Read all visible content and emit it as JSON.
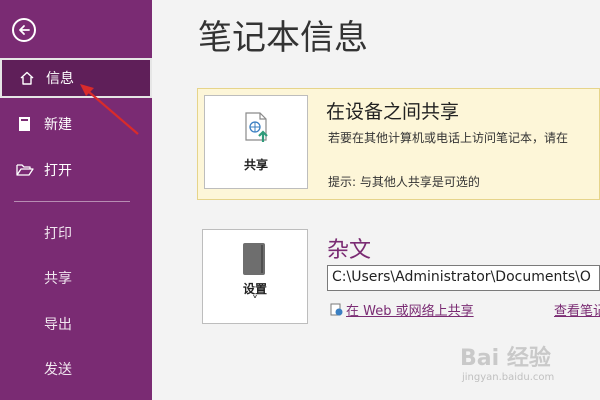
{
  "sidebar": {
    "items": [
      {
        "label": "信息",
        "icon": "home-icon"
      },
      {
        "label": "新建",
        "icon": "notebook-icon"
      },
      {
        "label": "打开",
        "icon": "folder-open-icon"
      }
    ],
    "sub_items": [
      "打印",
      "共享",
      "导出",
      "发送"
    ],
    "bg": "#7a2b73",
    "active_bg": "#5f1f59"
  },
  "main": {
    "title": "笔记本信息",
    "share": {
      "tile_label": "共享",
      "title": "在设备之间共享",
      "description": "若要在其他计算机或电话上访问笔记本，请在",
      "tip": "提示: 与其他人共享是可选的"
    },
    "notebook": {
      "tile_label": "设置",
      "tile_caret": "˅",
      "name": "杂文",
      "path": "C:\\Users\\Administrator\\Documents\\O",
      "web_link": "在 Web 或网络上共享",
      "view_link": "查看笔记"
    }
  },
  "watermark": {
    "text": "Bai 经验",
    "sub": "jingyan.baidu.com"
  },
  "colors": {
    "accent": "#7a2b73",
    "annotation": "#d92b2b",
    "share_bg": "#fdf6d8"
  }
}
